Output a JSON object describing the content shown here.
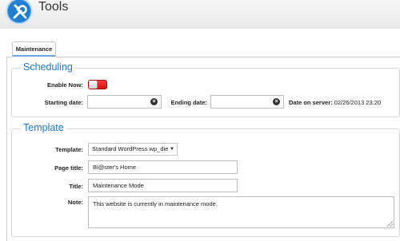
{
  "header": {
    "title": "Tools",
    "logo_icon": "wrench-screwdriver-icon"
  },
  "tabs": [
    {
      "label": "Maintenance",
      "active": true
    }
  ],
  "scheduling": {
    "legend": "Scheduling",
    "enable_now_label": "Enable Now:",
    "enable_now_state": "off",
    "starting_date_label": "Starting date:",
    "starting_date_value": "",
    "ending_date_label": "Ending date:",
    "ending_date_value": "",
    "server_date_label": "Date on server:",
    "server_date_value": "02/26/2013 23:20"
  },
  "template": {
    "legend": "Template",
    "template_label": "Template:",
    "template_selected": "Standard WordPress wp_die",
    "page_title_label": "Page title:",
    "page_title_value": "Bl@ster's Home",
    "title_label": "Title:",
    "title_value": "Maintenance Mode",
    "note_label": "Note:",
    "note_value": "This website is currently in maintenance mode."
  },
  "colors": {
    "accent": "#1b7bc9",
    "toggle_off": "#e01f1f"
  }
}
